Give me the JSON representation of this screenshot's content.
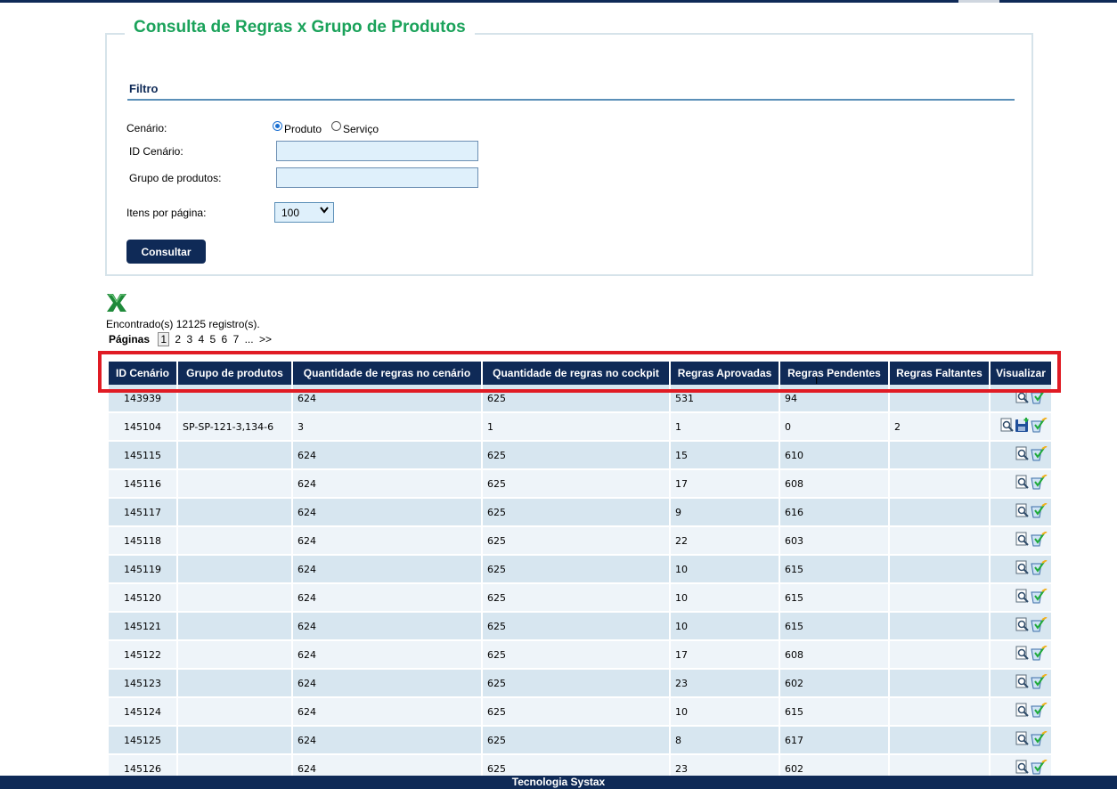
{
  "page": {
    "title": "Consulta de Regras x Grupo de Produtos"
  },
  "filter": {
    "section_title": "Filtro",
    "scenario_label": "Cenário:",
    "scenario_options": [
      "Produto",
      "Serviço"
    ],
    "scenario_selected": "Produto",
    "id_label": "ID Cenário:",
    "id_value": "",
    "group_label": "Grupo de produtos:",
    "group_value": "",
    "items_label": "Itens por página:",
    "items_value": "100",
    "submit_label": "Consultar"
  },
  "results": {
    "export_icon": "excel-icon",
    "found_text": "Encontrado(s) 12125 registro(s).",
    "pages_label": "Páginas",
    "pages": [
      "1",
      "2",
      "3",
      "4",
      "5",
      "6",
      "7"
    ],
    "current_page": "1",
    "ellipsis": "...",
    "next": ">>"
  },
  "table": {
    "headers": [
      "ID Cenário",
      "Grupo de produtos",
      "Quantidade de regras no cenário",
      "Quantidade de regras no cockpit",
      "Regras Aprovadas",
      "Regras Pendentes",
      "Regras Faltantes",
      "Visualizar"
    ],
    "rows": [
      {
        "id": "143939",
        "group": "",
        "qtd_cenario": "624",
        "qtd_cockpit": "625",
        "aprovadas": "531",
        "pendentes": "94",
        "faltantes": "",
        "icons": [
          "view-icon",
          "edit-rules-icon"
        ]
      },
      {
        "id": "145104",
        "group": "SP-SP-121-3,134-6",
        "qtd_cenario": "3",
        "qtd_cockpit": "1",
        "aprovadas": "1",
        "pendentes": "0",
        "faltantes": "2",
        "icons": [
          "view-icon",
          "save-icon",
          "edit-rules-icon"
        ]
      },
      {
        "id": "145115",
        "group": "",
        "qtd_cenario": "624",
        "qtd_cockpit": "625",
        "aprovadas": "15",
        "pendentes": "610",
        "faltantes": "",
        "icons": [
          "view-icon",
          "edit-rules-icon"
        ]
      },
      {
        "id": "145116",
        "group": "",
        "qtd_cenario": "624",
        "qtd_cockpit": "625",
        "aprovadas": "17",
        "pendentes": "608",
        "faltantes": "",
        "icons": [
          "view-icon",
          "edit-rules-icon"
        ]
      },
      {
        "id": "145117",
        "group": "",
        "qtd_cenario": "624",
        "qtd_cockpit": "625",
        "aprovadas": "9",
        "pendentes": "616",
        "faltantes": "",
        "icons": [
          "view-icon",
          "edit-rules-icon"
        ]
      },
      {
        "id": "145118",
        "group": "",
        "qtd_cenario": "624",
        "qtd_cockpit": "625",
        "aprovadas": "22",
        "pendentes": "603",
        "faltantes": "",
        "icons": [
          "view-icon",
          "edit-rules-icon"
        ]
      },
      {
        "id": "145119",
        "group": "",
        "qtd_cenario": "624",
        "qtd_cockpit": "625",
        "aprovadas": "10",
        "pendentes": "615",
        "faltantes": "",
        "icons": [
          "view-icon",
          "edit-rules-icon"
        ]
      },
      {
        "id": "145120",
        "group": "",
        "qtd_cenario": "624",
        "qtd_cockpit": "625",
        "aprovadas": "10",
        "pendentes": "615",
        "faltantes": "",
        "icons": [
          "view-icon",
          "edit-rules-icon"
        ]
      },
      {
        "id": "145121",
        "group": "",
        "qtd_cenario": "624",
        "qtd_cockpit": "625",
        "aprovadas": "10",
        "pendentes": "615",
        "faltantes": "",
        "icons": [
          "view-icon",
          "edit-rules-icon"
        ]
      },
      {
        "id": "145122",
        "group": "",
        "qtd_cenario": "624",
        "qtd_cockpit": "625",
        "aprovadas": "17",
        "pendentes": "608",
        "faltantes": "",
        "icons": [
          "view-icon",
          "edit-rules-icon"
        ]
      },
      {
        "id": "145123",
        "group": "",
        "qtd_cenario": "624",
        "qtd_cockpit": "625",
        "aprovadas": "23",
        "pendentes": "602",
        "faltantes": "",
        "icons": [
          "view-icon",
          "edit-rules-icon"
        ]
      },
      {
        "id": "145124",
        "group": "",
        "qtd_cenario": "624",
        "qtd_cockpit": "625",
        "aprovadas": "10",
        "pendentes": "615",
        "faltantes": "",
        "icons": [
          "view-icon",
          "edit-rules-icon"
        ]
      },
      {
        "id": "145125",
        "group": "",
        "qtd_cenario": "624",
        "qtd_cockpit": "625",
        "aprovadas": "8",
        "pendentes": "617",
        "faltantes": "",
        "icons": [
          "view-icon",
          "edit-rules-icon"
        ]
      },
      {
        "id": "145126",
        "group": "",
        "qtd_cenario": "624",
        "qtd_cockpit": "625",
        "aprovadas": "23",
        "pendentes": "602",
        "faltantes": "",
        "icons": [
          "view-icon",
          "edit-rules-icon"
        ]
      }
    ]
  },
  "footer": {
    "text": "Tecnologia Systax"
  },
  "colors": {
    "primary": "#0f2a57",
    "title_green": "#1aa25a",
    "row_odd": "#d7e6f0",
    "row_even": "#eef4f9",
    "input_bg": "#dff0fb",
    "highlight": "#e01b24"
  }
}
